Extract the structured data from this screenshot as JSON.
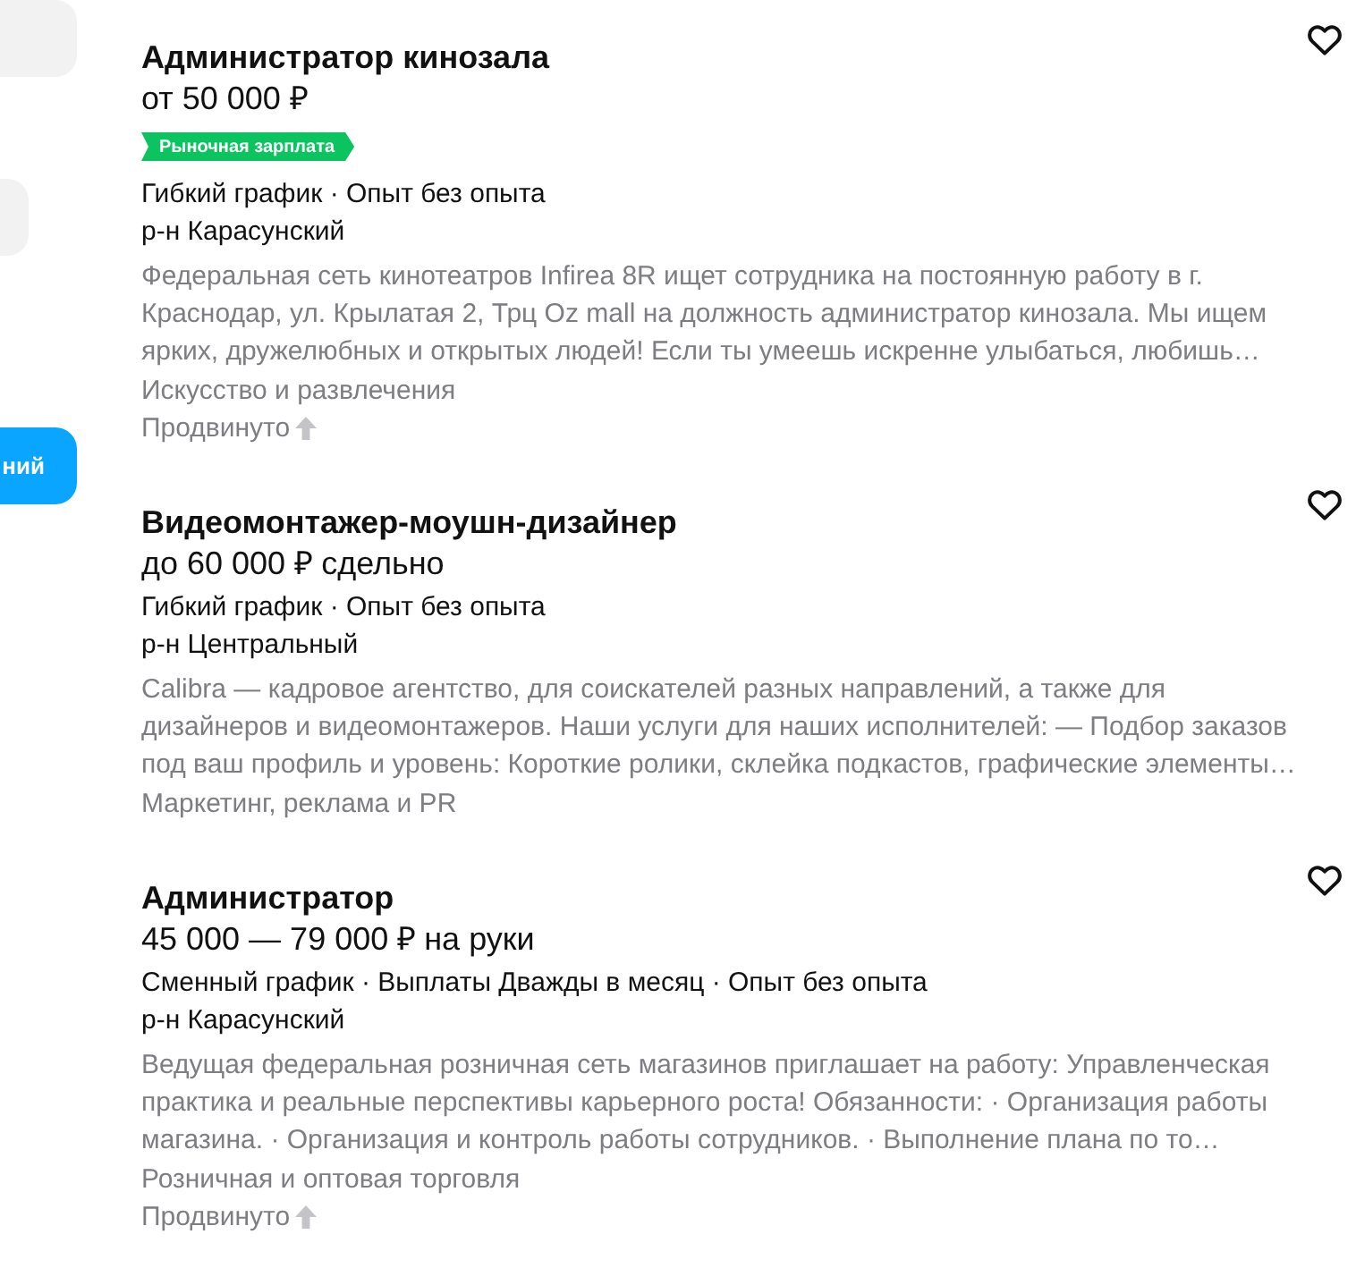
{
  "sidebar": {
    "button": {
      "label": "ний"
    }
  },
  "vacancies": [
    {
      "title": "Администратор кинозала",
      "salary": "от 50 000 ₽",
      "badge": "Рыночная зарплата",
      "meta": "Гибкий график · Опыт без опыта",
      "district": "р-н Карасунский",
      "description": "Федеральная сеть кинотеатров Infirea 8R ищет сотрудника на постоянную работу в г. Краснодар, ул. Крылатая 2, Трц Oz mall на должность администратор кинозала. Мы ищем ярких, дружелюбных и открытых людей! Если ты умеешь искренне улыбаться, любишь…",
      "category": "Искусство и развлечения",
      "promoted": "Продвинуто",
      "saved": false
    },
    {
      "title": "Видеомонтажер-моушн-дизайнер",
      "salary": "до 60 000 ₽ сдельно",
      "meta": "Гибкий график · Опыт без опыта",
      "district": "р-н Центральный",
      "description": "Calibra — кадровое агентство, для соискателей разных направлений, а также для дизайнеров и видеомонтажеров. Наши услуги для наших исполнителей: — Подбор заказов под ваш профиль и уровень: Короткие ролики, склейка подкастов, графические элементы…",
      "category": "Маркетинг, реклама и PR",
      "saved": false
    },
    {
      "title": "Администратор",
      "salary": "45 000 — 79 000 ₽ на руки",
      "meta": "Сменный график · Выплаты Дважды в месяц · Опыт без опыта",
      "district": "р-н Карасунский",
      "description": "Ведущая федеральная розничная сеть магазинов приглашает на работу: Управленческая практика и реальные перспективы карьерного роста! Обязанности: · Организация работы магазина. · Организация и контроль работы сотрудников. · Выполнение плана по то…",
      "category": "Розничная и оптовая торговля",
      "promoted": "Продвинуто",
      "saved": false
    }
  ]
}
